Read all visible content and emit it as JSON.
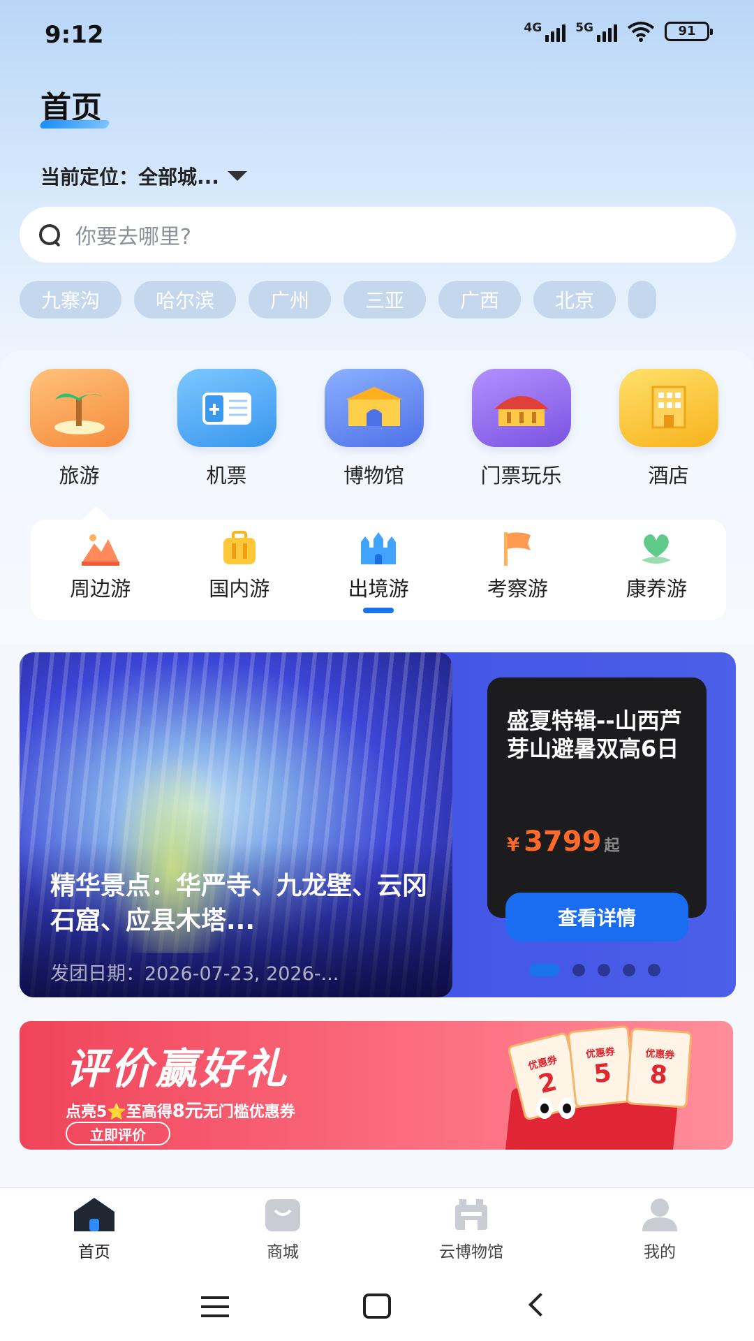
{
  "status_bar": {
    "time": "9:12",
    "net1": "4G",
    "net2": "5G",
    "battery": "91"
  },
  "header": {
    "title": "首页",
    "location_label": "当前定位：全部城..."
  },
  "search": {
    "placeholder": "你要去哪里?"
  },
  "chips": [
    "九寨沟",
    "哈尔滨",
    "广州",
    "三亚",
    "广西",
    "北京"
  ],
  "categories": [
    {
      "label": "旅游",
      "icon": "palm-island-icon",
      "color": "#f9a35a"
    },
    {
      "label": "机票",
      "icon": "ticket-plane-icon",
      "color": "#4aa8f5"
    },
    {
      "label": "博物馆",
      "icon": "museum-gate-icon",
      "color": "#5f86ef"
    },
    {
      "label": "门票玩乐",
      "icon": "palace-icon",
      "color": "#8b67e8"
    },
    {
      "label": "酒店",
      "icon": "hotel-building-icon",
      "color": "#f9c233"
    }
  ],
  "subnav": [
    {
      "label": "周边游",
      "icon": "mountain-icon"
    },
    {
      "label": "国内游",
      "icon": "suitcase-icon"
    },
    {
      "label": "出境游",
      "icon": "castle-icon",
      "active": true
    },
    {
      "label": "考察游",
      "icon": "flag-icon"
    },
    {
      "label": "康养游",
      "icon": "leaf-heart-icon"
    }
  ],
  "carousel": {
    "photo_title": "精华景点：华严寺、九龙壁、云冈石窟、应县木塔...",
    "photo_date": "发团日期：2026-07-23, 2026-...",
    "card_title": "盛夏特辑--山西芦芽山避暑双高6日",
    "price_currency": "¥",
    "price_value": "3799",
    "price_suffix": "起",
    "detail_button": "查看详情",
    "slide_count": 5,
    "active_slide": 1
  },
  "promo": {
    "title": "评价赢好礼",
    "subtitle_prefix": "点亮5⭐至高得",
    "subtitle_amount": "8元",
    "subtitle_suffix": "无门槛优惠券",
    "button": "立即评价",
    "coupon_label": "优惠券",
    "coupon_values": [
      "2",
      "5",
      "8"
    ]
  },
  "bottom_nav": [
    {
      "label": "首页",
      "icon": "home-icon",
      "active": true
    },
    {
      "label": "商城",
      "icon": "shop-bag-icon"
    },
    {
      "label": "云博物馆",
      "icon": "cloud-museum-icon"
    },
    {
      "label": "我的",
      "icon": "profile-icon"
    }
  ],
  "colors": {
    "accent": "#1a73e8",
    "price": "#ff6a2b",
    "promo": "#f0445a"
  }
}
